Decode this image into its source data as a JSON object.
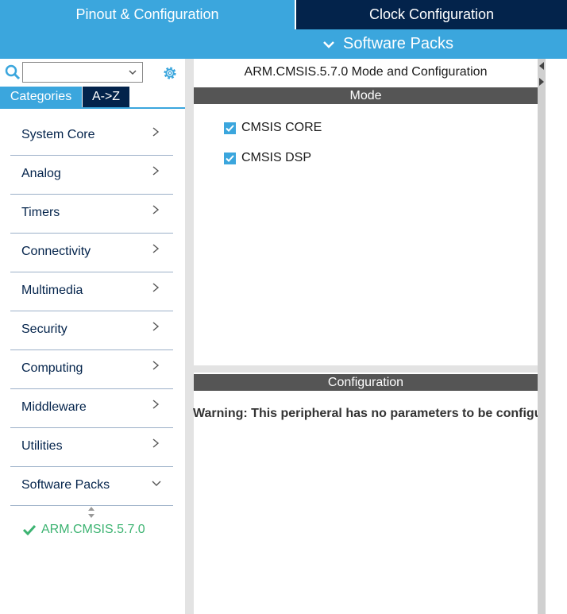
{
  "top_tabs": {
    "pinout": "Pinout & Configuration",
    "clock": "Clock Configuration"
  },
  "sub_bar": {
    "software_packs": "Software Packs"
  },
  "left": {
    "view_tabs": {
      "categories": "Categories",
      "az": "A->Z"
    },
    "categories": [
      {
        "label": "System Core"
      },
      {
        "label": "Analog"
      },
      {
        "label": "Timers"
      },
      {
        "label": "Connectivity"
      },
      {
        "label": "Multimedia"
      },
      {
        "label": "Security"
      },
      {
        "label": "Computing"
      },
      {
        "label": "Middleware"
      },
      {
        "label": "Utilities"
      },
      {
        "label": "Software Packs"
      }
    ],
    "pack_item": "ARM.CMSIS.5.7.0"
  },
  "mode": {
    "title": "ARM.CMSIS.5.7.0 Mode and Configuration",
    "header": "Mode",
    "checkboxes": [
      {
        "label": "CMSIS CORE",
        "checked": true
      },
      {
        "label": "CMSIS DSP",
        "checked": true
      }
    ]
  },
  "configuration": {
    "header": "Configuration",
    "warning": "Warning: This peripheral has no parameters to be configu"
  },
  "colors": {
    "accent": "#3ba6dd",
    "dark": "#03234b",
    "header_gray": "#555555",
    "ok_green": "#3cb371"
  }
}
